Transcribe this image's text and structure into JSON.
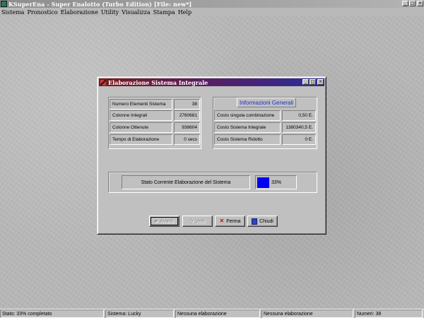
{
  "app": {
    "title": "KSuperEna - Super Enalotto (Turbo Edition) [File: new*]",
    "window_buttons": [
      "_",
      "□",
      "×"
    ]
  },
  "menubar": {
    "items": [
      "Sistema",
      "Pronostico",
      "Elaborazione",
      "Utility",
      "Visualizza",
      "Stampa",
      "Help"
    ]
  },
  "dialog": {
    "title": "Elaborazione Sistema Integrale",
    "window_buttons": [
      "_",
      "□",
      "×"
    ],
    "left_rows": [
      {
        "label": "Numero Elementi Sistema",
        "value": "38"
      },
      {
        "label": "Colonne Integrali",
        "value": "2760681"
      },
      {
        "label": "Colonne Ottenute",
        "value": "938604"
      },
      {
        "label": "Tempo di Elaborazione",
        "value": "0 secs"
      }
    ],
    "info_header": "Informazioni Generali",
    "right_rows": [
      {
        "label": "Costo singola combinazione",
        "value": "0,50 E."
      },
      {
        "label": "Costo Sistema Integrale",
        "value": "1380340,5 E."
      },
      {
        "label": "Costo Sistema Ridotto",
        "value": "0 E."
      }
    ],
    "status_label": "Stato Corrente Elaborazione del Sistema",
    "progress": {
      "percent": 33,
      "text": "33%",
      "color": "#0000f4"
    },
    "buttons": {
      "avanti": "Avanti",
      "vedi": "Vedi",
      "ferma": "Ferma",
      "chiudi": "Chiudi"
    }
  },
  "statusbar": {
    "cells": [
      "Stato: 33% completato",
      "Sistema: Lucky",
      "Nessuna elaborazione",
      "Nessuna elaborazione",
      "Numeri: 38"
    ]
  }
}
